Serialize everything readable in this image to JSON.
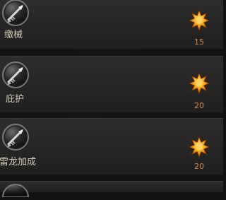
{
  "panel": {
    "items": [
      {
        "label": "缴械",
        "value": "15",
        "skill_icon": "spear-skill-icon",
        "reward_icon": "gold-star-icon"
      },
      {
        "label": "庇护",
        "value": "20",
        "skill_icon": "spear-skill-icon",
        "reward_icon": "gold-star-icon"
      },
      {
        "label": "雷龙加成",
        "value": "20",
        "skill_icon": "spear-skill-icon",
        "reward_icon": "gold-star-icon"
      }
    ]
  }
}
